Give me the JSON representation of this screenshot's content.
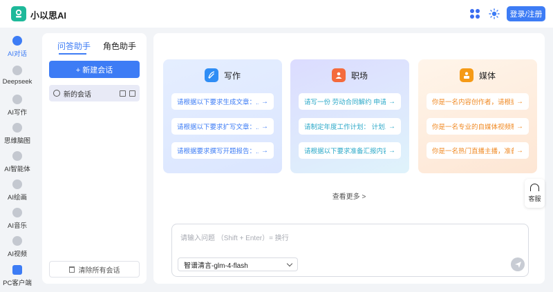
{
  "header": {
    "app_title": "小以思AI",
    "login_label": "登录/注册"
  },
  "nav": {
    "items": [
      {
        "label": "AI对话",
        "icon": "chat-icon",
        "active": true
      },
      {
        "label": "Deepseek",
        "icon": "whale-icon"
      },
      {
        "label": "AI写作",
        "icon": "pen-icon"
      },
      {
        "label": "思维脑图",
        "icon": "mindmap-icon"
      },
      {
        "label": "AI智能体",
        "icon": "agent-icon"
      },
      {
        "label": "AI绘画",
        "icon": "palette-icon"
      },
      {
        "label": "AI音乐",
        "icon": "music-icon"
      },
      {
        "label": "AI视频",
        "icon": "video-icon"
      },
      {
        "label": "PC客户端",
        "icon": "desktop-icon"
      }
    ]
  },
  "sessions": {
    "tab_qa": "问答助手",
    "tab_role": "角色助手",
    "new_label": "+ 新建会话",
    "items": [
      {
        "label": "新的会话"
      }
    ],
    "clear_label": "清除所有会话"
  },
  "cards": {
    "write": {
      "title": "写作",
      "prompts": [
        "请根据以下要求生成文章：...",
        "请根据以下要求扩写文章：...",
        "请根据要求撰写开题报告：..."
      ]
    },
    "work": {
      "title": "职场",
      "prompts": [
        "请写一份 劳动合同解约 申请...",
        "请制定年度工作计划： 计划...",
        "请根据以下要求准备汇报内容..."
      ]
    },
    "media": {
      "title": "媒体",
      "prompts": [
        "你是一名内容创作者，请根据...",
        "你是一名专业的自媒体视频制...",
        "你是一名热门直播主播，准备..."
      ]
    }
  },
  "more_label": "查看更多 >",
  "service_label": "客服",
  "input": {
    "placeholder": "请输入问题 （Shift + Enter）= 换行",
    "model": "智谱清言-glm-4-flash"
  },
  "colors": {
    "accent": "#3d7cf5",
    "logo": "#1eb99a",
    "write": "#2f8df5",
    "work": "#f46a3c",
    "media": "#f59a16"
  }
}
